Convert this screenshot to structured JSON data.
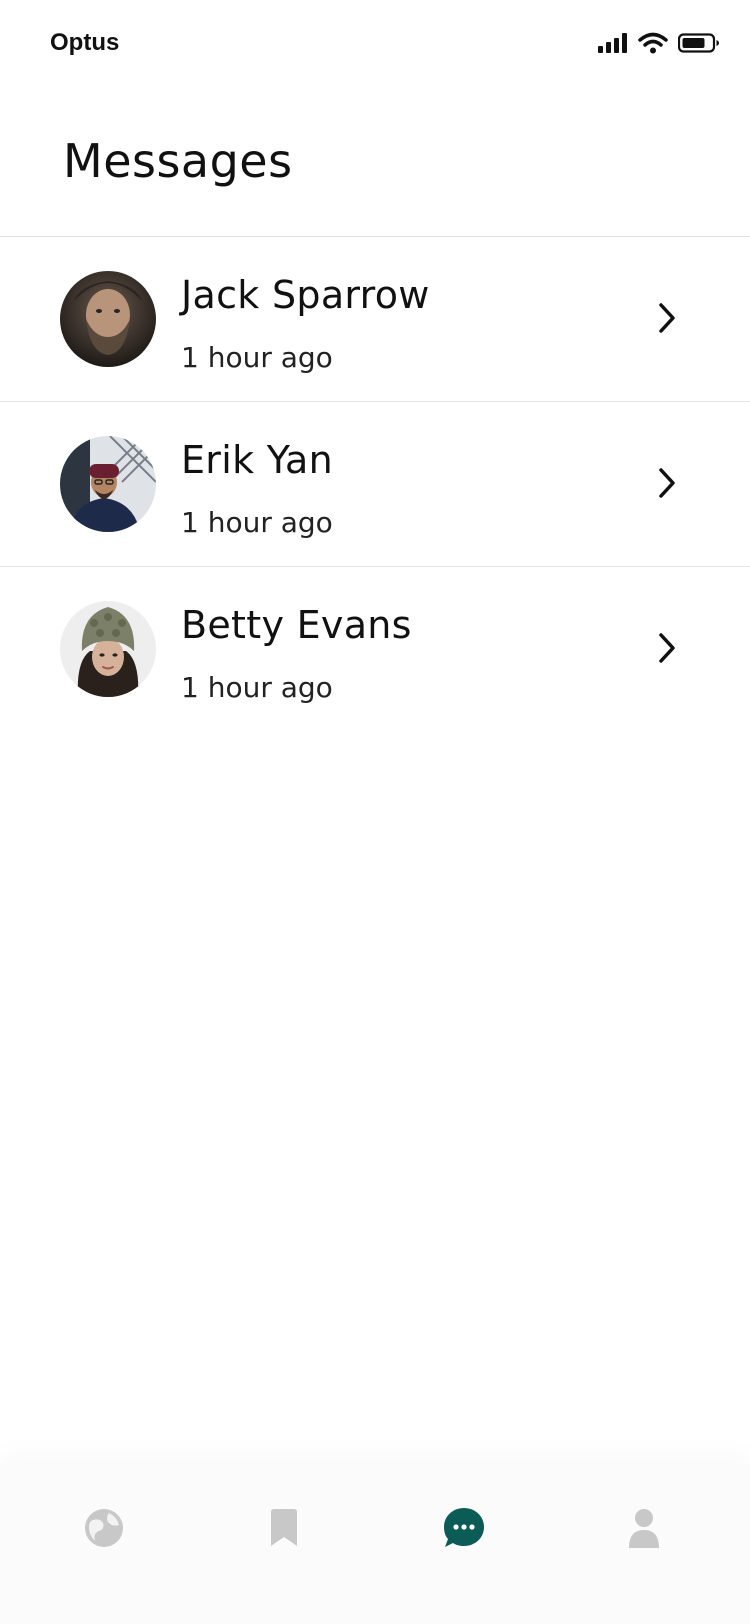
{
  "status_bar": {
    "carrier": "Optus",
    "icons": [
      "signal-icon",
      "wifi-icon",
      "battery-icon"
    ]
  },
  "page": {
    "title": "Messages"
  },
  "messages": [
    {
      "name": "Jack Sparrow",
      "time": "1 hour ago",
      "avatar": "avatar-jack"
    },
    {
      "name": "Erik Yan",
      "time": "1 hour ago",
      "avatar": "avatar-erik"
    },
    {
      "name": "Betty Evans",
      "time": "1 hour ago",
      "avatar": "avatar-betty"
    }
  ],
  "bottom_nav": {
    "items": [
      "explore-icon",
      "bookmark-icon",
      "messages-icon",
      "profile-icon"
    ],
    "active": "messages-icon"
  },
  "colors": {
    "accent": "#0b5c57",
    "inactive_icon": "#c8c8c8",
    "divider": "#e2e2e2"
  }
}
